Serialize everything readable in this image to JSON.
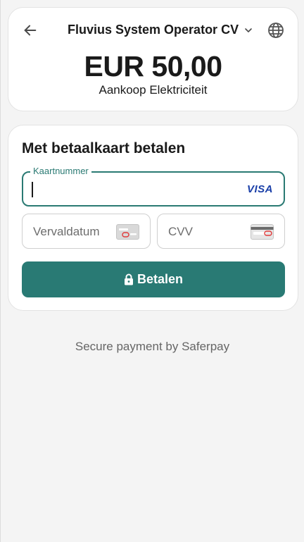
{
  "header": {
    "merchant": "Fluvius System Operator CV",
    "amount": "EUR 50,00",
    "description": "Aankoop Elektriciteit"
  },
  "payment": {
    "title": "Met betaalkaart betalen",
    "card_number_label": "Kaartnummer",
    "card_brand": "VISA",
    "expiry_placeholder": "Vervaldatum",
    "cvv_placeholder": "CVV",
    "pay_button": "Betalen"
  },
  "footer": {
    "text": "Secure payment by Saferpay"
  },
  "colors": {
    "accent": "#297a74",
    "visa_blue": "#1a3fa8"
  },
  "icons": {
    "back": "arrow-left-icon",
    "merchant_dropdown": "chevron-down-icon",
    "language": "globe-icon",
    "expiry": "card-front-icon",
    "cvv": "card-back-icon",
    "pay": "lock-icon"
  }
}
